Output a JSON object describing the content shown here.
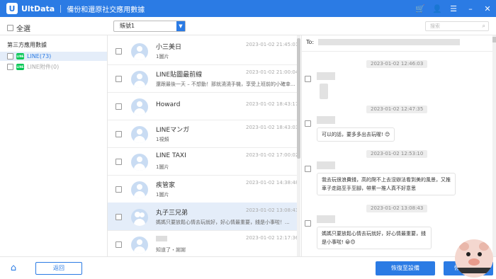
{
  "app": {
    "brand": "UltData",
    "window_title": "備份和還原社交應用數據",
    "accent": "#2b7be4"
  },
  "titlebar_icons": [
    "cart-icon",
    "user-icon",
    "menu-icon",
    "minimize-icon",
    "close-icon"
  ],
  "toolbar": {
    "select_all": "全選",
    "sort_value": "賬號1",
    "search_placeholder": "搜索"
  },
  "sidebar": {
    "header": "第三方應用數據",
    "items": [
      {
        "label": "LINE(73)",
        "active": true
      },
      {
        "label": "LINE附件(0)",
        "active": false
      }
    ]
  },
  "chats": [
    {
      "name": "小三美日",
      "preview": "1圖片",
      "time": "2023-01-02 21:45:01",
      "group": false
    },
    {
      "name": "LINE貼圖最前線",
      "preview": "還跟最後一天 – 不想動！那就澆澆手機，享受上班前的小確幸...",
      "time": "2023-01-02 21:00:04",
      "group": false
    },
    {
      "name": "Howard",
      "preview": "",
      "time": "2023-01-02 18:43:17",
      "group": false
    },
    {
      "name": "LINEマンガ",
      "preview": "1視頻",
      "time": "2023-01-02 18:43:03",
      "group": false
    },
    {
      "name": "LINE TAXI",
      "preview": "1圖片",
      "time": "2023-01-02 17:00:02",
      "group": false
    },
    {
      "name": "疾管家",
      "preview": "1圖片",
      "time": "2023-01-02 14:38:48",
      "group": false
    },
    {
      "name": "丸子三兄弟",
      "preview": "媽媽只要放鬆心情去玩就好，好心情最重要，錢是小事啦！...",
      "time": "2023-01-02 13:08:43",
      "group": true,
      "selected": true
    },
    {
      "name": "",
      "preview": "知道了・謝謝",
      "time": "2023-01-02 12:17:36",
      "group": false
    }
  ],
  "conversation": {
    "to_label": "To:",
    "messages": [
      {
        "stamp": "2023-01-02 12:46:03",
        "text": ""
      },
      {
        "stamp": "2023-01-02 12:47:35",
        "text": "可以的話，要多多出去玩喔! 😊"
      },
      {
        "stamp": "2023-01-02 12:53:10",
        "text": "我去玩很浪費錢，高的爬不上去沒辦法看到美的風景，又推車子走路至手至腳，帶累一推人真不好意思"
      },
      {
        "stamp": "2023-01-02 13:08:43",
        "text": "媽媽只要放鬆心情去玩就好，好心情最重要，錢是小事啦! 😀😊"
      }
    ]
  },
  "bottom": {
    "back_label": "返回",
    "restore_device_label": "恢復至設備",
    "restore_pc_label": "恢復至電腦"
  }
}
